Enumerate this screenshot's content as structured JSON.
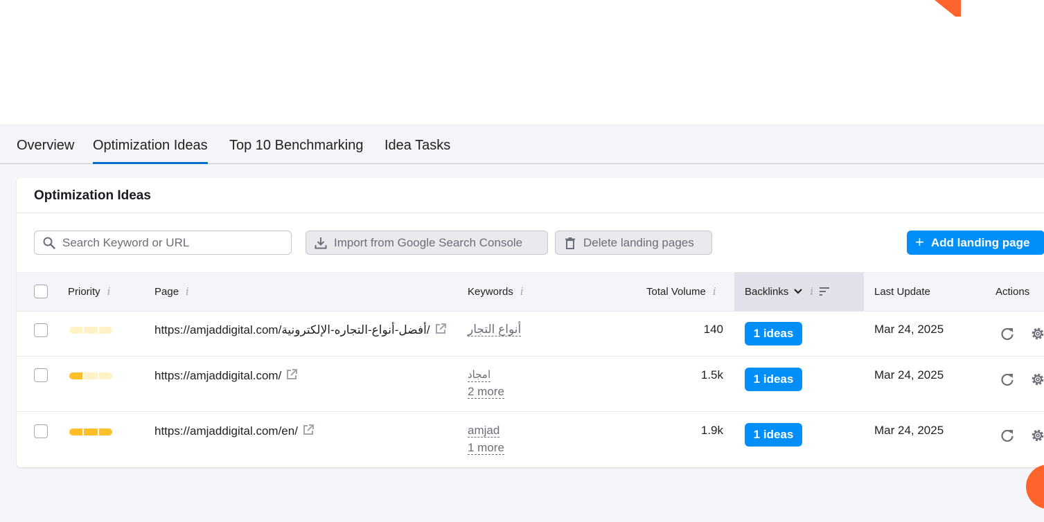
{
  "tabs": [
    {
      "label": "Overview"
    },
    {
      "label": "Optimization Ideas"
    },
    {
      "label": "Top 10 Benchmarking"
    },
    {
      "label": "Idea Tasks"
    }
  ],
  "card": {
    "title": "Optimization Ideas"
  },
  "toolbar": {
    "search_placeholder": "Search Keyword or URL",
    "import_label": "Import from Google Search Console",
    "delete_label": "Delete landing pages",
    "add_label": "Add landing page"
  },
  "table": {
    "headers": {
      "priority": "Priority",
      "page": "Page",
      "keywords": "Keywords",
      "total_volume": "Total Volume",
      "backlinks": "Backlinks",
      "last_update": "Last Update",
      "actions": "Actions"
    },
    "info_glyph": "i",
    "rows": [
      {
        "priority_level": 0,
        "url": "https://amjaddigital.com/أفضل-أنواع-التجاره-الإلكترونية/",
        "keyword": "أنواع التجار",
        "more": "",
        "volume": "140",
        "ideas": "1 ideas",
        "date": "Mar 24, 2025"
      },
      {
        "priority_level": 1,
        "url": "https://amjaddigital.com/",
        "keyword": "امجاد",
        "more": "2 more",
        "volume": "1.5k",
        "ideas": "1 ideas",
        "date": "Mar 24, 2025"
      },
      {
        "priority_level": 3,
        "url": "https://amjaddigital.com/en/",
        "keyword": "amjad",
        "more": "1 more",
        "volume": "1.9k",
        "ideas": "1 ideas",
        "date": "Mar 24, 2025"
      }
    ]
  },
  "colors": {
    "accent": "#008ff8",
    "tab_underline": "#006dca",
    "priority_on": "#ffbf28",
    "priority_off": "#fff3c6",
    "brand_orange": "#ff642d"
  },
  "icons": [
    "search-icon",
    "download-icon",
    "trash-icon",
    "plus-icon",
    "external-link-icon",
    "refresh-icon",
    "gear-icon",
    "chevron-down-icon",
    "sort-icon"
  ]
}
